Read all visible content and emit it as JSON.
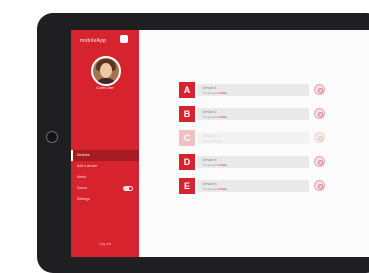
{
  "sidebar": {
    "logo": "mobileApp",
    "user_name": "Guest User",
    "menu": [
      {
        "label": "Devices",
        "active": true
      },
      {
        "label": "Add a device",
        "active": false
      },
      {
        "label": "Alerts",
        "active": false
      },
      {
        "label": "Sound",
        "active": false,
        "toggle": true
      },
      {
        "label": "Settings",
        "active": false
      }
    ],
    "logout": "Log out"
  },
  "devices": [
    {
      "letter": "A",
      "name": "Device 1",
      "status": "Connected",
      "status_highlight": "Online",
      "dimmed": false
    },
    {
      "letter": "B",
      "name": "Device 2",
      "status": "Connected",
      "status_highlight": "Online",
      "dimmed": false
    },
    {
      "letter": "C",
      "name": "Device 3",
      "status": "Disconnected",
      "status_highlight": "",
      "dimmed": true
    },
    {
      "letter": "D",
      "name": "Device 4",
      "status": "Connected",
      "status_highlight": "Online",
      "dimmed": false
    },
    {
      "letter": "E",
      "name": "Device 5",
      "status": "Connected",
      "status_highlight": "Online",
      "dimmed": false
    }
  ],
  "colors": {
    "accent": "#d7232d",
    "tablet_frame": "#1f1f21",
    "content_bg": "#fbfbfb"
  }
}
